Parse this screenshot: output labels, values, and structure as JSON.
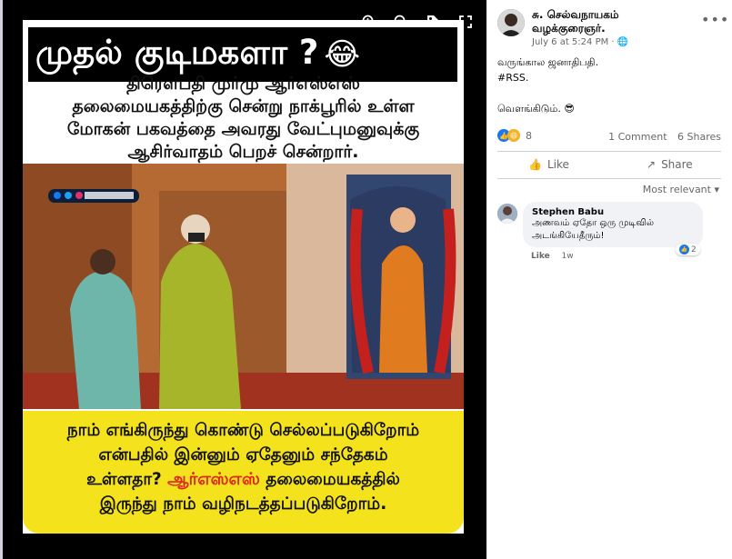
{
  "viewer": {
    "toolbar": {
      "zoom_in": "zoom-in-icon",
      "zoom_out": "zoom-out-icon",
      "tag": "tag-icon",
      "fullscreen": "fullscreen-icon"
    },
    "image": {
      "title": "முதல் குடிமகளா ?",
      "title_emoji": "😂",
      "top_text": "திரௌபதி முர்மு ஆர்எஸ்எஸ்\nதலைமையகத்திற்கு சென்று நாக்பூரில் உள்ள\nமோகன் பகவத்தை அவரது வேட்புமனுவுக்கு\nஆசிர்வாதம் பெறச் சென்றார்.",
      "bottom_text_1": "நாம் எங்கிருந்து கொண்டு செல்லப்படுகிறோம்\nஎன்பதில் இன்னும் ஏதேனும் சந்தேகம்\nஉள்ளதா? ",
      "bottom_text_red": "ஆர்எஸ்எஸ்",
      "bottom_text_2": " தலைமையகத்தில்\nஇருந்து நாம் வழிநடத்தப்படுகிறோம்."
    }
  },
  "post": {
    "author_line1": "சு. செல்வநாயகம்",
    "author_line2": "வழக்குரைஞர்.",
    "timestamp": "July 6 at 5:24 PM",
    "audience_icon": "globe-icon",
    "caption_line1": "வருங்கால ஜனாதிபதி.",
    "caption_line2": "#RSS.",
    "caption_line3": "வெளங்கிடும். 😎",
    "reactions_count": "8",
    "comments_count": "1 Comment",
    "shares_count": "6 Shares",
    "like_label": "Like",
    "share_label": "Share",
    "sort_label": "Most relevant"
  },
  "comment": {
    "name": "Stephen Babu",
    "text": "அணவம் ஏதோ ஒரு முடிவில் அடங்கியேதீரும்!",
    "reaction_count": "2",
    "like_label": "Like",
    "time": "1w"
  },
  "colors": {
    "accent": "#1877f2",
    "yellow_box": "#f4e21d",
    "red_text": "#e0241b"
  }
}
